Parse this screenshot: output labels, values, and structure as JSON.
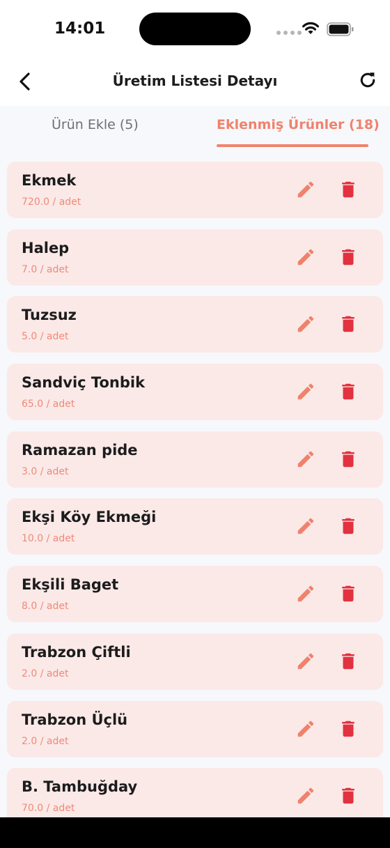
{
  "status": {
    "time": "14:01"
  },
  "header": {
    "title": "Üretim Listesi Detayı"
  },
  "tabs": [
    {
      "label": "Ürün Ekle (5)",
      "active": false
    },
    {
      "label": "Eklenmiş Ürünler (18)",
      "active": true
    }
  ],
  "colors": {
    "accent": "#f0826c",
    "card_bg": "#fbe9e8",
    "delete": "#e2323f"
  },
  "items": [
    {
      "name": "Ekmek",
      "qty": "720.0 / adet"
    },
    {
      "name": "Halep",
      "qty": "7.0 / adet"
    },
    {
      "name": "Tuzsuz",
      "qty": "5.0 / adet"
    },
    {
      "name": "Sandviç Tonbik",
      "qty": "65.0 / adet"
    },
    {
      "name": "Ramazan pide",
      "qty": "3.0 / adet"
    },
    {
      "name": "Ekşi Köy Ekmeği",
      "qty": "10.0 / adet"
    },
    {
      "name": "Ekşili Baget",
      "qty": "8.0 / adet"
    },
    {
      "name": "Trabzon Çiftli",
      "qty": "2.0 / adet"
    },
    {
      "name": "Trabzon Üçlü",
      "qty": "2.0 / adet"
    },
    {
      "name": "B. Tambuğday",
      "qty": "70.0 / adet"
    }
  ]
}
